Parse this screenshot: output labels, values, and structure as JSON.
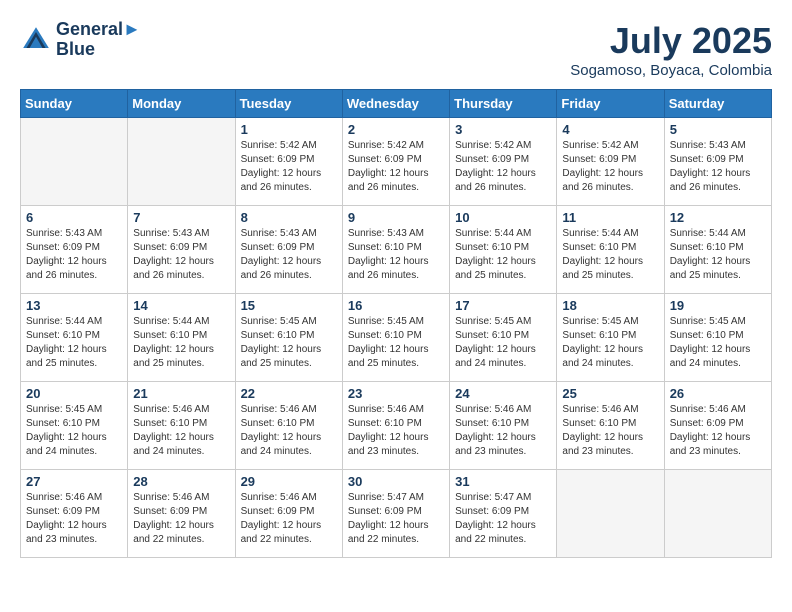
{
  "header": {
    "logo_line1": "General",
    "logo_line2": "Blue",
    "month": "July 2025",
    "location": "Sogamoso, Boyaca, Colombia"
  },
  "days_of_week": [
    "Sunday",
    "Monday",
    "Tuesday",
    "Wednesday",
    "Thursday",
    "Friday",
    "Saturday"
  ],
  "weeks": [
    [
      {
        "day": "",
        "info": ""
      },
      {
        "day": "",
        "info": ""
      },
      {
        "day": "1",
        "info": "Sunrise: 5:42 AM\nSunset: 6:09 PM\nDaylight: 12 hours\nand 26 minutes."
      },
      {
        "day": "2",
        "info": "Sunrise: 5:42 AM\nSunset: 6:09 PM\nDaylight: 12 hours\nand 26 minutes."
      },
      {
        "day": "3",
        "info": "Sunrise: 5:42 AM\nSunset: 6:09 PM\nDaylight: 12 hours\nand 26 minutes."
      },
      {
        "day": "4",
        "info": "Sunrise: 5:42 AM\nSunset: 6:09 PM\nDaylight: 12 hours\nand 26 minutes."
      },
      {
        "day": "5",
        "info": "Sunrise: 5:43 AM\nSunset: 6:09 PM\nDaylight: 12 hours\nand 26 minutes."
      }
    ],
    [
      {
        "day": "6",
        "info": "Sunrise: 5:43 AM\nSunset: 6:09 PM\nDaylight: 12 hours\nand 26 minutes."
      },
      {
        "day": "7",
        "info": "Sunrise: 5:43 AM\nSunset: 6:09 PM\nDaylight: 12 hours\nand 26 minutes."
      },
      {
        "day": "8",
        "info": "Sunrise: 5:43 AM\nSunset: 6:09 PM\nDaylight: 12 hours\nand 26 minutes."
      },
      {
        "day": "9",
        "info": "Sunrise: 5:43 AM\nSunset: 6:10 PM\nDaylight: 12 hours\nand 26 minutes."
      },
      {
        "day": "10",
        "info": "Sunrise: 5:44 AM\nSunset: 6:10 PM\nDaylight: 12 hours\nand 25 minutes."
      },
      {
        "day": "11",
        "info": "Sunrise: 5:44 AM\nSunset: 6:10 PM\nDaylight: 12 hours\nand 25 minutes."
      },
      {
        "day": "12",
        "info": "Sunrise: 5:44 AM\nSunset: 6:10 PM\nDaylight: 12 hours\nand 25 minutes."
      }
    ],
    [
      {
        "day": "13",
        "info": "Sunrise: 5:44 AM\nSunset: 6:10 PM\nDaylight: 12 hours\nand 25 minutes."
      },
      {
        "day": "14",
        "info": "Sunrise: 5:44 AM\nSunset: 6:10 PM\nDaylight: 12 hours\nand 25 minutes."
      },
      {
        "day": "15",
        "info": "Sunrise: 5:45 AM\nSunset: 6:10 PM\nDaylight: 12 hours\nand 25 minutes."
      },
      {
        "day": "16",
        "info": "Sunrise: 5:45 AM\nSunset: 6:10 PM\nDaylight: 12 hours\nand 25 minutes."
      },
      {
        "day": "17",
        "info": "Sunrise: 5:45 AM\nSunset: 6:10 PM\nDaylight: 12 hours\nand 24 minutes."
      },
      {
        "day": "18",
        "info": "Sunrise: 5:45 AM\nSunset: 6:10 PM\nDaylight: 12 hours\nand 24 minutes."
      },
      {
        "day": "19",
        "info": "Sunrise: 5:45 AM\nSunset: 6:10 PM\nDaylight: 12 hours\nand 24 minutes."
      }
    ],
    [
      {
        "day": "20",
        "info": "Sunrise: 5:45 AM\nSunset: 6:10 PM\nDaylight: 12 hours\nand 24 minutes."
      },
      {
        "day": "21",
        "info": "Sunrise: 5:46 AM\nSunset: 6:10 PM\nDaylight: 12 hours\nand 24 minutes."
      },
      {
        "day": "22",
        "info": "Sunrise: 5:46 AM\nSunset: 6:10 PM\nDaylight: 12 hours\nand 24 minutes."
      },
      {
        "day": "23",
        "info": "Sunrise: 5:46 AM\nSunset: 6:10 PM\nDaylight: 12 hours\nand 23 minutes."
      },
      {
        "day": "24",
        "info": "Sunrise: 5:46 AM\nSunset: 6:10 PM\nDaylight: 12 hours\nand 23 minutes."
      },
      {
        "day": "25",
        "info": "Sunrise: 5:46 AM\nSunset: 6:10 PM\nDaylight: 12 hours\nand 23 minutes."
      },
      {
        "day": "26",
        "info": "Sunrise: 5:46 AM\nSunset: 6:09 PM\nDaylight: 12 hours\nand 23 minutes."
      }
    ],
    [
      {
        "day": "27",
        "info": "Sunrise: 5:46 AM\nSunset: 6:09 PM\nDaylight: 12 hours\nand 23 minutes."
      },
      {
        "day": "28",
        "info": "Sunrise: 5:46 AM\nSunset: 6:09 PM\nDaylight: 12 hours\nand 22 minutes."
      },
      {
        "day": "29",
        "info": "Sunrise: 5:46 AM\nSunset: 6:09 PM\nDaylight: 12 hours\nand 22 minutes."
      },
      {
        "day": "30",
        "info": "Sunrise: 5:47 AM\nSunset: 6:09 PM\nDaylight: 12 hours\nand 22 minutes."
      },
      {
        "day": "31",
        "info": "Sunrise: 5:47 AM\nSunset: 6:09 PM\nDaylight: 12 hours\nand 22 minutes."
      },
      {
        "day": "",
        "info": ""
      },
      {
        "day": "",
        "info": ""
      }
    ]
  ]
}
